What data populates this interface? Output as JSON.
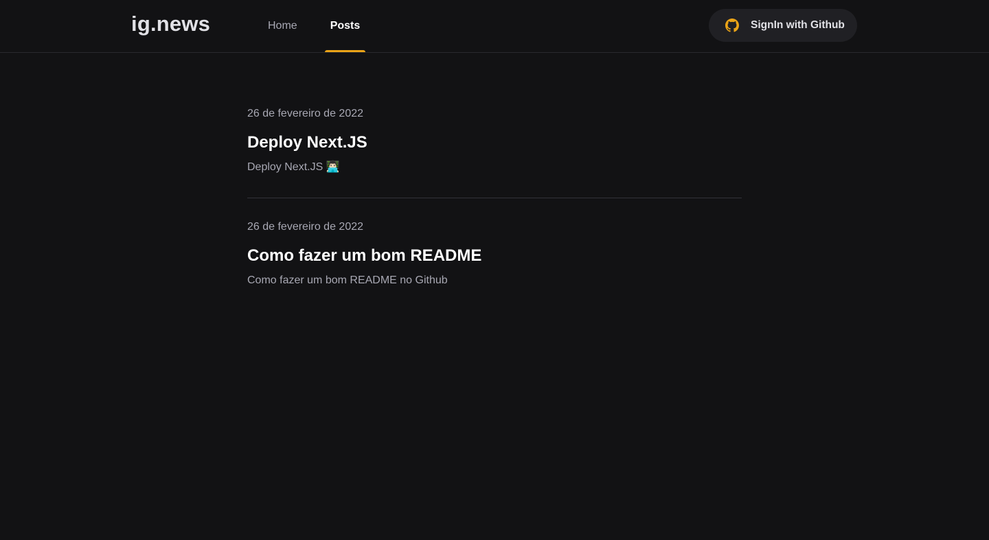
{
  "header": {
    "logo": "ig.news",
    "nav": [
      {
        "label": "Home",
        "active": false
      },
      {
        "label": "Posts",
        "active": true
      }
    ],
    "signin": {
      "label": "SignIn with Github",
      "icon": "github-icon",
      "icon_color": "#eba417"
    }
  },
  "colors": {
    "background": "#121214",
    "accent": "#eba417",
    "muted_text": "#a8a8b3",
    "title_text": "#ffffff",
    "divider": "#323238"
  },
  "posts": [
    {
      "date": "26 de fevereiro de 2022",
      "title": "Deploy Next.JS",
      "excerpt": "Deploy Next.JS 👨🏻‍💻"
    },
    {
      "date": "26 de fevereiro de 2022",
      "title": "Como fazer um bom README",
      "excerpt": "Como fazer um bom README no Github"
    }
  ]
}
